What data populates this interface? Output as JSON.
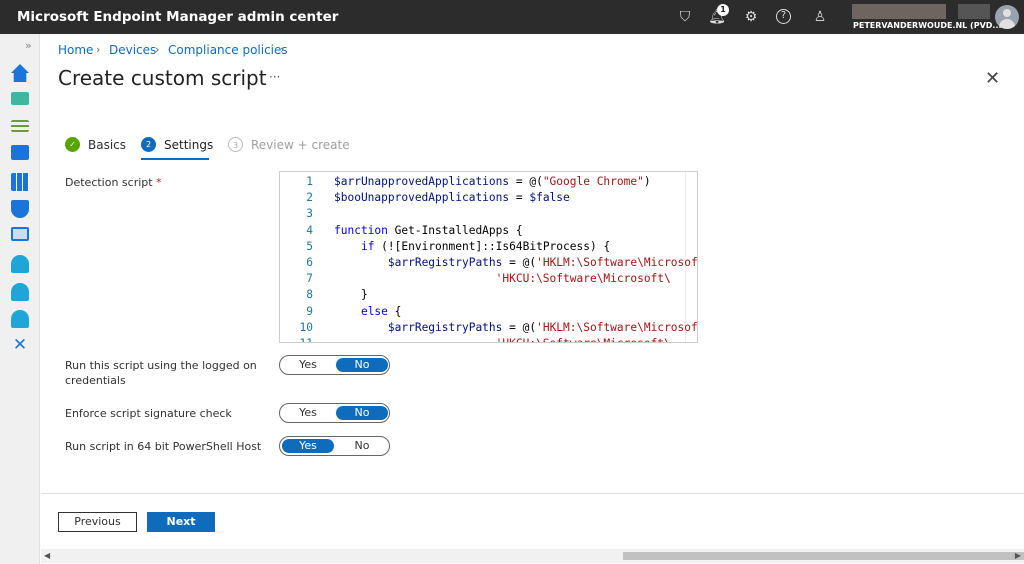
{
  "header": {
    "title": "Microsoft Endpoint Manager admin center",
    "notification_count": "1",
    "tenant": "PETERVANDERWOUDE.NL (PVD...",
    "icons": [
      "feedback-filter-icon",
      "bell-icon",
      "gear-icon",
      "help-icon",
      "feedback-person-icon"
    ]
  },
  "sidebar": {
    "items": [
      "home",
      "dashboard",
      "all-services",
      "devices",
      "apps",
      "endpoint-security",
      "reports",
      "users",
      "groups",
      "tenant-administration",
      "troubleshooting"
    ]
  },
  "breadcrumb": [
    "Home",
    "Devices",
    "Compliance policies"
  ],
  "page": {
    "title": "Create custom script",
    "more": "···",
    "close": "✕"
  },
  "steps": [
    {
      "num": "✓",
      "label": "Basics"
    },
    {
      "num": "2",
      "label": "Settings"
    },
    {
      "num": "3",
      "label": "Review + create"
    }
  ],
  "detection": {
    "label": "Detection script",
    "required": "*"
  },
  "code": [
    [
      [
        "v",
        "$arrUnapprovedApplications"
      ],
      [
        "p",
        " = @("
      ],
      [
        "s",
        "\"Google Chrome\""
      ],
      [
        "p",
        ")"
      ]
    ],
    [
      [
        "v",
        "$booUnapprovedApplications"
      ],
      [
        "p",
        " = "
      ],
      [
        "v",
        "$false"
      ]
    ],
    [],
    [
      [
        "k",
        "function"
      ],
      [
        "p",
        " Get-InstalledApps {"
      ]
    ],
    [
      [
        "p",
        "    "
      ],
      [
        "k",
        "if"
      ],
      [
        "p",
        " (![Environment]::Is64BitProcess) {"
      ]
    ],
    [
      [
        "p",
        "        "
      ],
      [
        "v",
        "$arrRegistryPaths"
      ],
      [
        "p",
        " = @("
      ],
      [
        "s",
        "'HKLM:\\Software\\Microsoft\\"
      ]
    ],
    [
      [
        "p",
        "                        "
      ],
      [
        "s",
        "'HKCU:\\Software\\Microsoft\\"
      ]
    ],
    [
      [
        "p",
        "    }"
      ]
    ],
    [
      [
        "p",
        "    "
      ],
      [
        "k",
        "else"
      ],
      [
        "p",
        " {"
      ]
    ],
    [
      [
        "p",
        "        "
      ],
      [
        "v",
        "$arrRegistryPaths"
      ],
      [
        "p",
        " = @("
      ],
      [
        "s",
        "'HKLM:\\Software\\Microsoft\\"
      ]
    ],
    [
      [
        "p",
        "                        "
      ],
      [
        "s",
        "'HKCU:\\Software\\Microsoft\\"
      ]
    ]
  ],
  "settings": [
    {
      "label": "Run this script using the logged on credentials",
      "yes": "Yes",
      "no": "No",
      "value": "No"
    },
    {
      "label": "Enforce script signature check",
      "yes": "Yes",
      "no": "No",
      "value": "No"
    },
    {
      "label": "Run script in 64 bit PowerShell Host",
      "yes": "Yes",
      "no": "No",
      "value": "Yes"
    }
  ],
  "footer": {
    "previous": "Previous",
    "next": "Next"
  }
}
